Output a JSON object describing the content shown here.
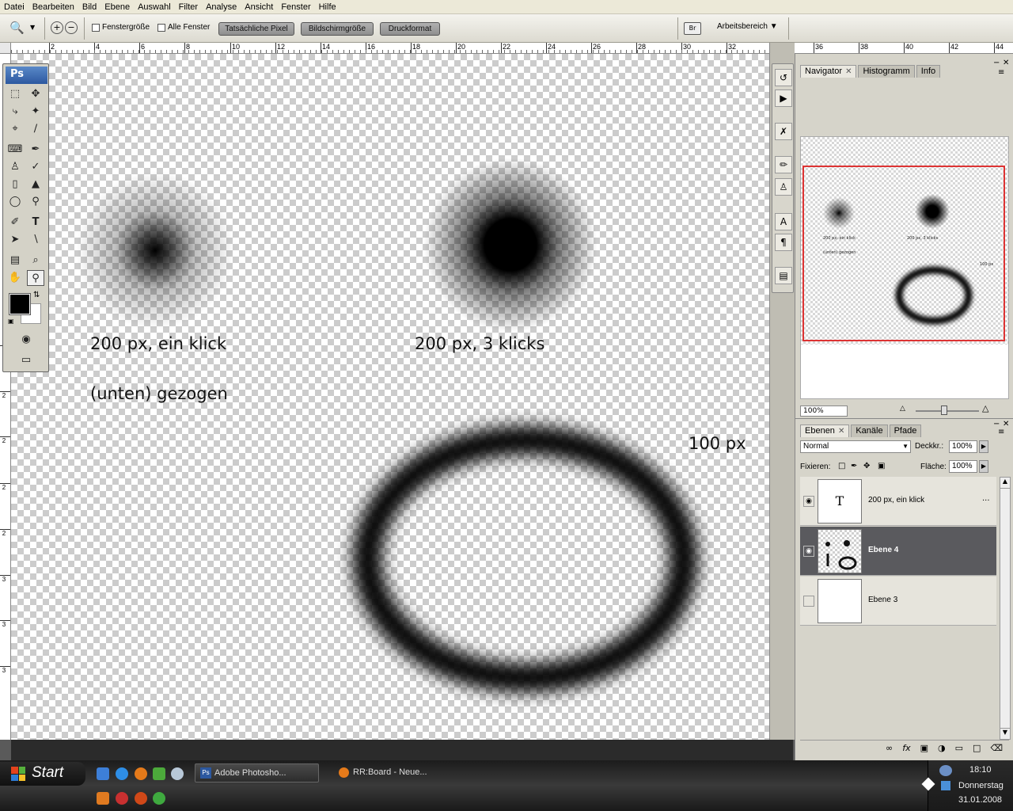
{
  "menu": [
    "Datei",
    "Bearbeiten",
    "Bild",
    "Ebene",
    "Auswahl",
    "Filter",
    "Analyse",
    "Ansicht",
    "Fenster",
    "Hilfe"
  ],
  "options": {
    "check_fenster": "Fenstergröße",
    "check_alle": "Alle Fenster",
    "btn_pixel": "Tatsächliche Pixel",
    "btn_bildschirm": "Bildschirmgröße",
    "btn_druck": "Druckformat",
    "workspace": "Arbeitsbereich"
  },
  "ruler_top": [
    "2",
    "4",
    "6",
    "8",
    "10",
    "12",
    "14",
    "16",
    "18",
    "20",
    "22",
    "24",
    "26",
    "28",
    "30",
    "32",
    "36",
    "38",
    "40",
    "42",
    "44"
  ],
  "ruler_left": [
    "2",
    "2",
    "2",
    "2",
    "2",
    "3",
    "3",
    "3"
  ],
  "canvas": {
    "label1": "200 px, ein klick",
    "label2": "200 px, 3 klicks",
    "label3": "(unten) gezogen",
    "label4": "100 px"
  },
  "tools": {
    "logo": "Ps"
  },
  "navigator": {
    "tabs": [
      "Navigator",
      "Histogramm",
      "Info"
    ],
    "zoom": "100%",
    "thumb_labels": [
      "200 px, ein klick",
      "200 px, 3 klicks",
      "(unten) gezogen",
      "100 px"
    ]
  },
  "layers_panel": {
    "tabs": [
      "Ebenen",
      "Kanäle",
      "Pfade"
    ],
    "blend_mode": "Normal",
    "opacity_label": "Deckkr.:",
    "opacity": "100%",
    "lock_label": "Fixieren:",
    "fill_label": "Fläche:",
    "fill": "100%",
    "layers": [
      {
        "name": "200 px, ein klick",
        "type_glyph": "T",
        "more": "..."
      },
      {
        "name": "Ebene 4"
      },
      {
        "name": "Ebene 3"
      }
    ]
  },
  "taskbar": {
    "start": "Start",
    "task1": "Adobe Photosho...",
    "task2": "RR:Board - Neue...",
    "time": "18:10",
    "day": "Donnerstag",
    "date": "31.01.2008"
  }
}
